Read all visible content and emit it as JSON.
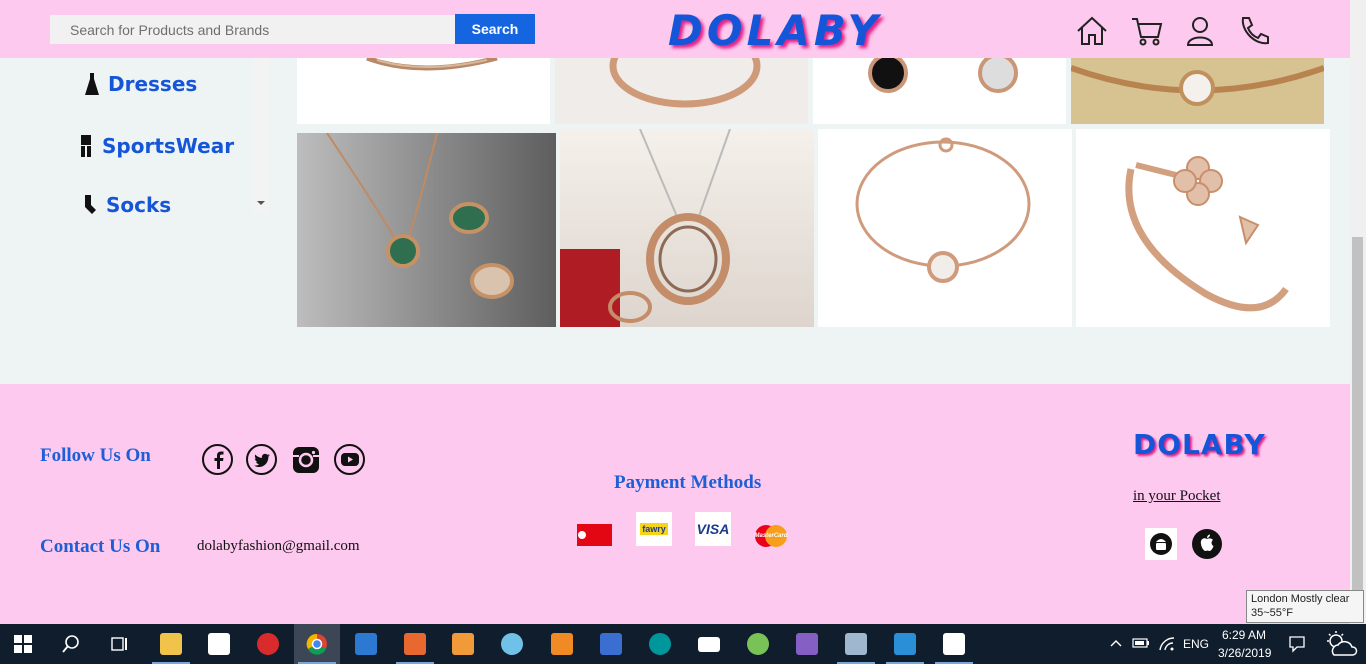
{
  "header": {
    "search_placeholder": "Search for Products and Brands",
    "search_button": "Search",
    "logo": "DOLABY",
    "nav_icons": [
      "home-icon",
      "cart-icon",
      "user-icon",
      "phone-icon"
    ]
  },
  "sidebar": {
    "items": [
      {
        "label": "Dresses",
        "icon": "dress-icon"
      },
      {
        "label": "SportsWear",
        "icon": "sportswear-icon"
      },
      {
        "label": "Socks",
        "icon": "sock-icon"
      }
    ]
  },
  "gallery": {
    "items": [
      "necklace",
      "ring",
      "earrings",
      "bracelet-chain",
      "necklace-and-rings",
      "ring-pendant",
      "bracelet",
      "flower-cuff"
    ]
  },
  "footer": {
    "follow_label": "Follow Us On",
    "social_icons": [
      "facebook-icon",
      "twitter-icon",
      "instagram-icon",
      "youtube-icon"
    ],
    "contact_label": "Contact Us On",
    "email": "dolabyfashion@gmail.com",
    "payment_label": "Payment Methods",
    "payment_methods": [
      {
        "name": "vodafone-cash",
        "text": ""
      },
      {
        "name": "fawry",
        "text": "fawry"
      },
      {
        "name": "visa",
        "text": "VISA"
      },
      {
        "name": "mastercard",
        "text": "MasterCard"
      }
    ],
    "logo": "DOLABY",
    "pocket": "in your Pocket",
    "store_icons": [
      "android-icon",
      "apple-icon"
    ]
  },
  "tooltip": {
    "line1": "London Mostly clear",
    "line2": "35~55°F"
  },
  "taskbar": {
    "apps": [
      "file-explorer",
      "store",
      "app-red",
      "chrome",
      "outlook",
      "app-orange",
      "media-player",
      "paint",
      "pdf-app",
      "remote-app",
      "arduino",
      "mail",
      "android-studio",
      "visual-studio",
      "photos",
      "app-blue",
      "movie-maker"
    ],
    "language": "ENG",
    "time": "6:29 AM",
    "date": "3/26/2019"
  },
  "colors": {
    "pink": "#fdc9ee",
    "blue": "#1556d8",
    "accent_shadow": "#e0238a",
    "taskbar": "#101d2c"
  }
}
